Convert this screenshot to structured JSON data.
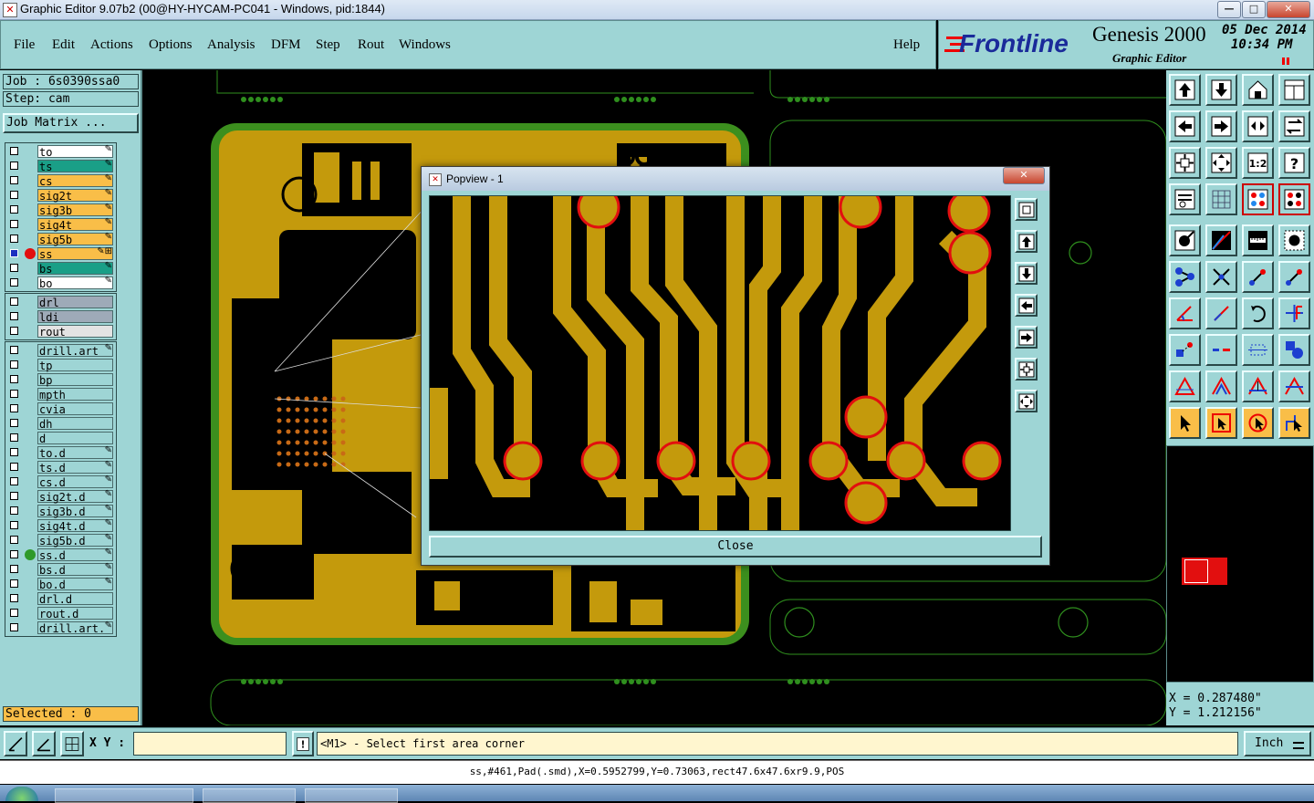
{
  "window": {
    "title": "Graphic Editor 9.07b2 (00@HY-HYCAM-PC041 - Windows, pid:1844)"
  },
  "menu": {
    "items": [
      "File",
      "Edit",
      "Actions",
      "Options",
      "Analysis",
      "DFM",
      "Step",
      "Rout",
      "Windows"
    ],
    "help": "Help"
  },
  "brand": {
    "logo": "Frontline",
    "product": "Genesis 2000",
    "subtitle": "Graphic Editor",
    "date": "05 Dec 2014",
    "time": "10:34 PM"
  },
  "job": {
    "job_label": "Job : 6s0390ssa0",
    "step_label": "Step: cam",
    "matrix_button": "Job Matrix ..."
  },
  "layers": {
    "group1": [
      {
        "name": "to",
        "color": "#ffffff"
      },
      {
        "name": "ts",
        "color": "#1a9f87"
      },
      {
        "name": "cs",
        "color": "#f9be48"
      },
      {
        "name": "sig2t",
        "color": "#f9be48"
      },
      {
        "name": "sig3b",
        "color": "#f9be48"
      },
      {
        "name": "sig4t",
        "color": "#f9be48"
      },
      {
        "name": "sig5b",
        "color": "#f9be48"
      },
      {
        "name": "ss",
        "color": "#f9be48"
      },
      {
        "name": "bs",
        "color": "#1a9f87"
      },
      {
        "name": "bo",
        "color": "#ffffff"
      }
    ],
    "group2": [
      {
        "name": "drl",
        "color": "#9eaab8"
      },
      {
        "name": "ldi",
        "color": "#9eaab8"
      },
      {
        "name": "rout",
        "color": "#e3e3e3"
      }
    ],
    "group3": [
      {
        "name": "drill.art"
      },
      {
        "name": "tp"
      },
      {
        "name": "bp"
      },
      {
        "name": "mpth"
      },
      {
        "name": "cvia"
      },
      {
        "name": "dh"
      },
      {
        "name": "d"
      },
      {
        "name": "to.d"
      },
      {
        "name": "ts.d"
      },
      {
        "name": "cs.d"
      },
      {
        "name": "sig2t.d"
      },
      {
        "name": "sig3b.d"
      },
      {
        "name": "sig4t.d"
      },
      {
        "name": "sig5b.d"
      },
      {
        "name": "ss.d"
      },
      {
        "name": "bs.d"
      },
      {
        "name": "bo.d"
      },
      {
        "name": "drl.d"
      },
      {
        "name": "rout.d"
      },
      {
        "name": "drill.art."
      }
    ]
  },
  "selected": "Selected : 0",
  "popview": {
    "title": "Popview - 1",
    "close_label": "Close"
  },
  "coords": {
    "x": "X  =  0.287480\"",
    "y": "Y  =  1.212156\""
  },
  "command": {
    "xy_label": "X Y :",
    "xy_value": "",
    "prompt": "<M1> - Select first area corner",
    "units": "Inch"
  },
  "status": {
    "text": "ss,#461,Pad(.smd),X=0.5952799,Y=0.73063,rect47.6x47.6xr9.9,POS"
  },
  "colors": {
    "panel": "#9ed5d5",
    "copper": "#c49a0c",
    "board_outline": "#3c8f1e",
    "pad_ring": "#ff1d1d"
  }
}
